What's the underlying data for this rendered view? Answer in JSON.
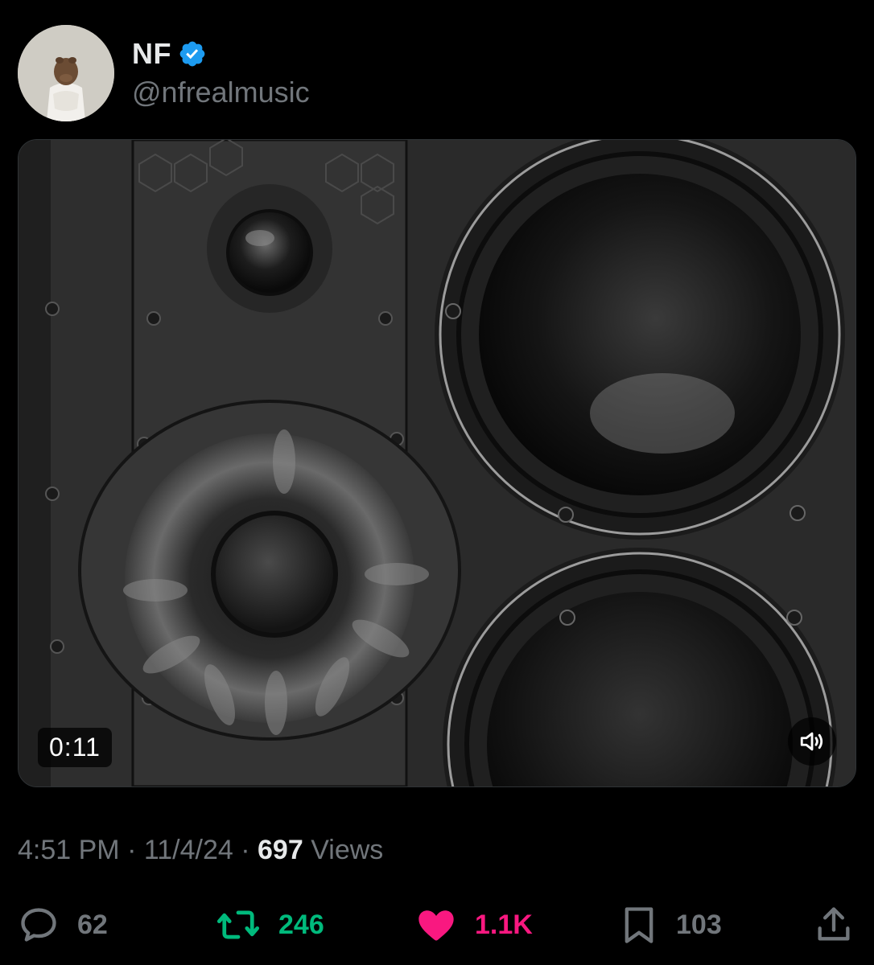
{
  "post": {
    "author": {
      "display_name": "NF",
      "handle": "@nfrealmusic",
      "verified": true,
      "verified_icon": "verified-badge-icon"
    },
    "media": {
      "type": "video",
      "duration": "0:11",
      "sound_icon": "speaker-icon"
    },
    "meta": {
      "time": "4:51 PM",
      "separator": "·",
      "date": "11/4/24",
      "views_count": "697",
      "views_label": "Views"
    },
    "actions": {
      "replies": "62",
      "reposts": "246",
      "likes": "1.1K",
      "bookmarks": "103"
    }
  },
  "colors": {
    "background": "#000000",
    "text_primary": "#e7e9ea",
    "text_secondary": "#71767b",
    "verified_blue": "#1d9bf0",
    "repost_green": "#00ba7c",
    "like_pink": "#f91880"
  }
}
